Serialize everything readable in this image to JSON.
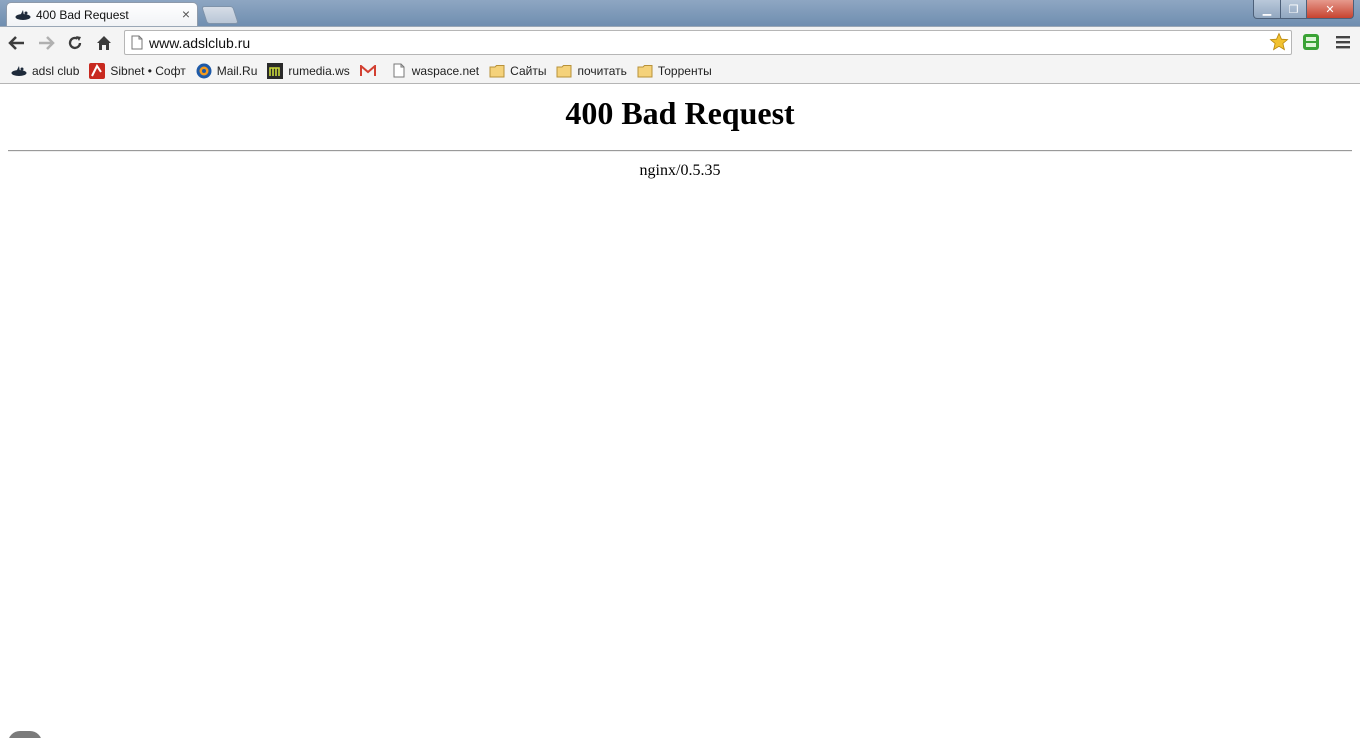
{
  "browser": {
    "tab": {
      "title": "400 Bad Request",
      "close_glyph": "×",
      "favicon": "adsl-club-icon"
    },
    "window_controls": {
      "minimize": "▁",
      "maximize": "❐",
      "close": "✕"
    },
    "toolbar": {
      "back": "back-arrow-icon",
      "forward": "forward-arrow-icon",
      "reload": "reload-icon",
      "home": "home-icon",
      "url": "www.adslclub.ru",
      "star": "bookmark-star-icon",
      "extension": "extension-icon",
      "menu": "menu-icon"
    },
    "bookmarks": [
      {
        "label": "adsl club",
        "icon": "adsl-club-icon"
      },
      {
        "label": "Sibnet • Софт",
        "icon": "sibnet-icon"
      },
      {
        "label": "Mail.Ru",
        "icon": "mailru-icon"
      },
      {
        "label": "rumedia.ws",
        "icon": "rumedia-icon"
      },
      {
        "label": "",
        "icon": "gmail-icon"
      },
      {
        "label": "waspace.net",
        "icon": "page-icon"
      },
      {
        "label": "Сайты",
        "icon": "folder-icon"
      },
      {
        "label": "почитать",
        "icon": "folder-icon"
      },
      {
        "label": "Торренты",
        "icon": "folder-icon"
      }
    ]
  },
  "page": {
    "heading": "400 Bad Request",
    "server": "nginx/0.5.35"
  },
  "colors": {
    "tabstrip": "#6f8eb0",
    "toolbar": "#f4f4f4",
    "star": "#f2c230",
    "extension": "#3aa335"
  }
}
